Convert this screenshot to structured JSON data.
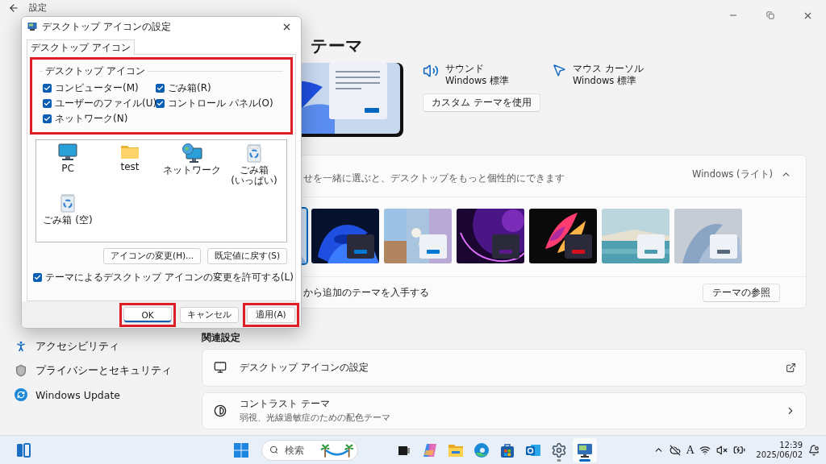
{
  "window": {
    "title": "設定"
  },
  "page": {
    "heading": "テーマ"
  },
  "theme_summary": {
    "items": [
      {
        "kind": "sound",
        "label": "サウンド",
        "value": "Windows 標準"
      },
      {
        "kind": "cursor",
        "label": "マウス カーソル",
        "value": "Windows 標準"
      }
    ],
    "button": "カスタム テーマを使用"
  },
  "current_theme": {
    "description": "せを一緒に選ぶと、デスクトップをもっと個性的にできます",
    "value": "Windows (ライト)",
    "expanded": true,
    "themes": [
      {
        "selected": true
      },
      {
        "selected": false,
        "kind": "dark",
        "color": "#0078d4"
      },
      {
        "selected": false,
        "kind": "light",
        "color": "#0078d4"
      },
      {
        "selected": false,
        "kind": "dark",
        "color": "#5b1a8c"
      },
      {
        "selected": false,
        "kind": "dark",
        "color": "#d40f1e"
      },
      {
        "selected": false,
        "kind": "light",
        "color": "#4a9bb0"
      },
      {
        "selected": false,
        "kind": "light",
        "color": "#56687a"
      }
    ],
    "store_row": {
      "text": "から追加のテーマを入手する",
      "button": "テーマの参照"
    }
  },
  "related": {
    "heading": "関連設定",
    "items": [
      {
        "kind": "desktop_icons",
        "title": "デスクトップ アイコンの設定"
      },
      {
        "kind": "contrast",
        "title": "コントラスト テーマ",
        "subtitle": "弱視、光線過敏症のための配色テーマ"
      }
    ]
  },
  "sidebar": {
    "items": [
      {
        "kind": "accessibility",
        "label": "アクセシビリティ"
      },
      {
        "kind": "privacy",
        "label": "プライバシーとセキュリティ"
      },
      {
        "kind": "update",
        "label": "Windows Update"
      }
    ]
  },
  "dialog": {
    "title": "デスクトップ アイコンの設定",
    "tabs": [
      {
        "label": "デスクトップ アイコン",
        "selected": true
      }
    ],
    "group": {
      "label": "デスクトップ アイコン",
      "highlighted": true,
      "checkboxes": [
        {
          "label": "コンピューター(M)",
          "checked": true
        },
        {
          "label": "ごみ箱(R)",
          "checked": true
        },
        {
          "label": "ユーザーのファイル(U)",
          "checked": true
        },
        {
          "label": "コントロール パネル(O)",
          "checked": true
        },
        {
          "label": "ネットワーク(N)",
          "checked": true
        }
      ]
    },
    "icons": [
      {
        "kind": "pc",
        "label": "PC"
      },
      {
        "kind": "folder",
        "label": "test"
      },
      {
        "kind": "network",
        "label": "ネットワーク"
      },
      {
        "kind": "bin_full",
        "label": "ごみ箱\n(いっぱい)"
      },
      {
        "kind": "bin_empty",
        "label": "ごみ箱 (空)"
      }
    ],
    "icon_buttons": [
      "アイコンの変更(H)...",
      "既定値に戻す(S)"
    ],
    "allow_themes": {
      "label": "テーマによるデスクトップ アイコンの変更を許可する(L)",
      "checked": true
    },
    "buttons": [
      {
        "label": "OK",
        "highlighted": true,
        "default": true
      },
      {
        "label": "キャンセル",
        "highlighted": false,
        "default": false
      },
      {
        "label": "適用(A)",
        "highlighted": true,
        "default": false
      }
    ]
  },
  "taskbar": {
    "search": {
      "placeholder": "検索"
    },
    "apps": [
      {
        "kind": "task_view",
        "running": false,
        "selected": false
      },
      {
        "kind": "copilot",
        "running": false,
        "selected": false
      },
      {
        "kind": "explorer",
        "running": false,
        "selected": false
      },
      {
        "kind": "edge",
        "running": false,
        "selected": false
      },
      {
        "kind": "store",
        "running": false,
        "selected": false
      },
      {
        "kind": "outlook",
        "running": false,
        "selected": false
      },
      {
        "kind": "settings",
        "running": true,
        "selected": false
      },
      {
        "kind": "desktop_settings",
        "running": true,
        "selected": true
      }
    ],
    "tray": {
      "ime": "A",
      "time": "12:39",
      "date": "2025/06/02"
    }
  }
}
